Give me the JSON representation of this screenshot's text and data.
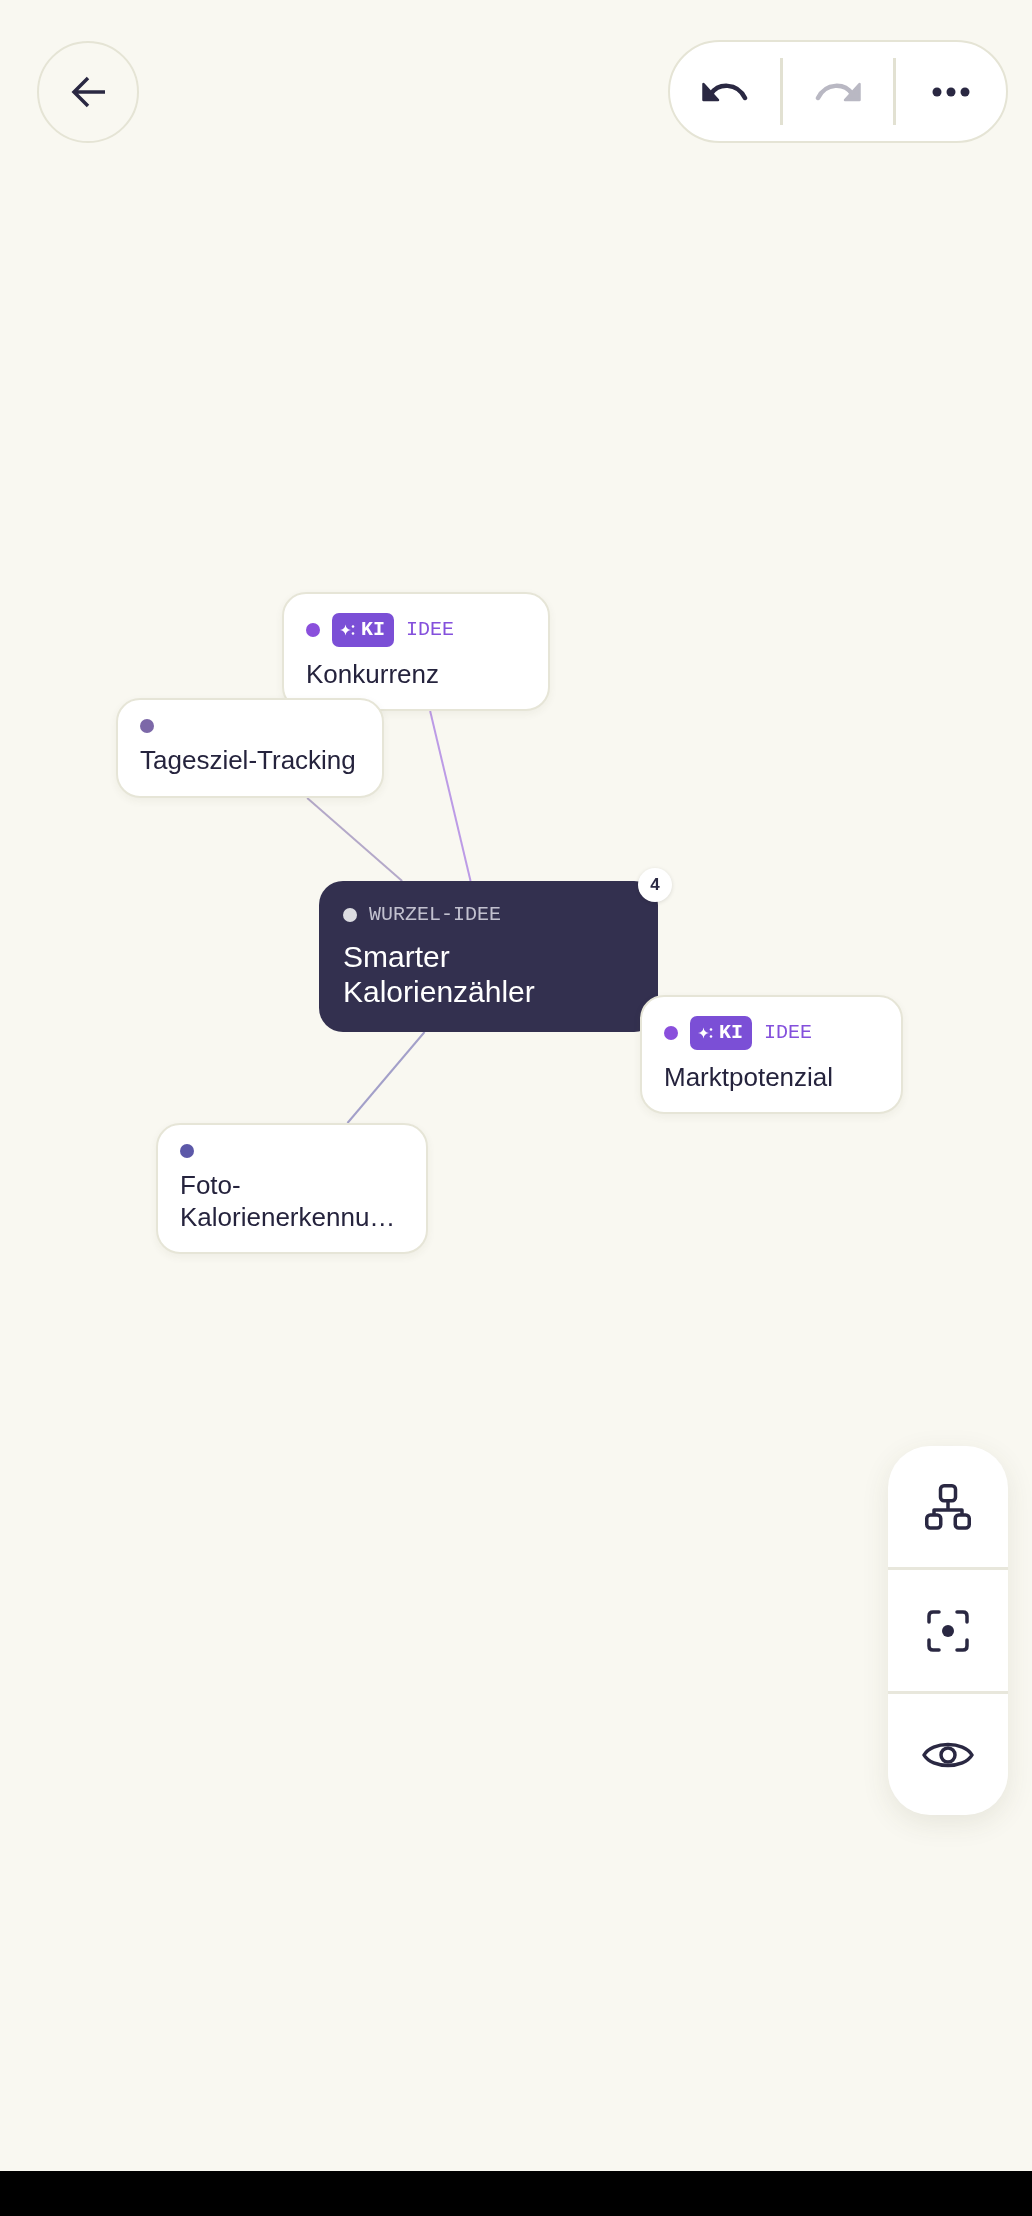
{
  "top_bar": {
    "actions": [
      {
        "kind": "undo",
        "disabled": false
      },
      {
        "kind": "redo",
        "disabled": true
      },
      {
        "kind": "more",
        "disabled": false
      }
    ]
  },
  "mind_map": {
    "root": {
      "label": "WURZEL-IDEE",
      "title": "Smarter Kalorienzähler",
      "color": "#dcdce2",
      "child_count": "4",
      "children": [
        {
          "title": "Konkurrenz",
          "color": "#8a4fdc",
          "tag": "KI",
          "label": "IDEE"
        },
        {
          "title": "Tagesziel-Tracking",
          "color": "#7c68a8"
        },
        {
          "title": "Marktpotenzial",
          "color": "#8a4fdc",
          "tag": "KI",
          "label": "IDEE"
        },
        {
          "title": "Foto-Kalorienerkennu…",
          "color": "#5c58a8"
        }
      ]
    }
  },
  "view_tools": [
    {
      "kind": "layout"
    },
    {
      "kind": "focus"
    },
    {
      "kind": "visibility"
    }
  ]
}
